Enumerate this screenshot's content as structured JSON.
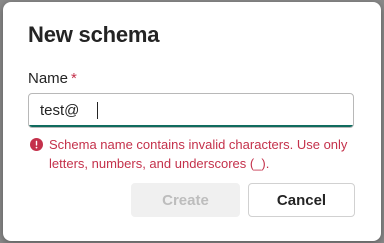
{
  "dialog": {
    "title": "New schema",
    "field": {
      "label": "Name",
      "required_marker": "*",
      "value": "test@"
    },
    "error": {
      "icon": "error-circle-icon",
      "message": "Schema name contains invalid characters. Use only letters, numbers, and underscores (_)."
    },
    "buttons": {
      "create_label": "Create",
      "cancel_label": "Cancel"
    }
  },
  "colors": {
    "accent": "#0f6b5e",
    "error": "#c4314b",
    "disabled_text": "#bdbdbd",
    "disabled_bg": "#f0f0f0"
  }
}
